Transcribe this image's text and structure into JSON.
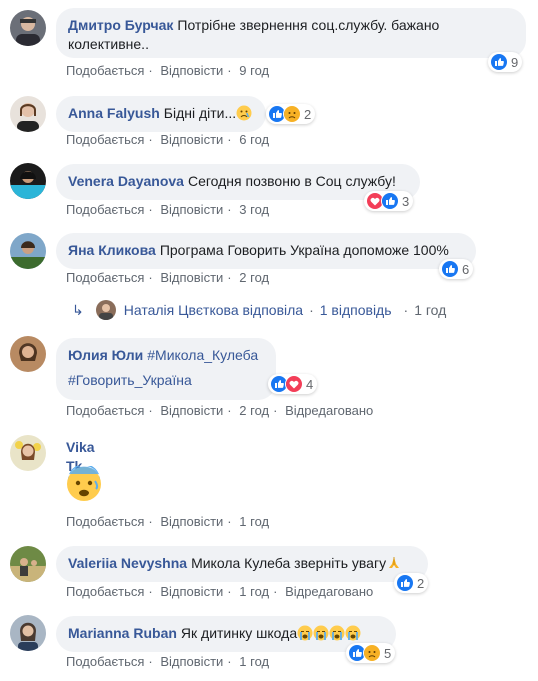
{
  "colors": {
    "link": "#385898",
    "bubble": "#f0f2f5",
    "meta": "#606770",
    "like_blue": "#1877f2",
    "love_red": "#f33e58",
    "haha_yellow": "#f7b125"
  },
  "actions": {
    "like": "Подобається",
    "reply": "Відповісти",
    "edited": "Відредаговано"
  },
  "comments": [
    {
      "author": "Дмитро Бурчак",
      "text": "Потрібне звернення соц.службу. бажано колективне..",
      "time": "9 год",
      "reactions": [
        "like"
      ],
      "count": "9"
    },
    {
      "author": "Anna Falyush",
      "text": "Бідні діти...",
      "emoji": "sad",
      "time": "6 год",
      "reactions": [
        "like",
        "sad"
      ],
      "count": "2"
    },
    {
      "author": "Venera Dayanova",
      "text": "Сегодня позвоню в Соц службу!",
      "time": "3 год",
      "reactions": [
        "love",
        "like"
      ],
      "count": "3"
    },
    {
      "author": "Яна Кликова",
      "text": "Програма Говорить Україна допоможе 100%",
      "time": "2 год",
      "reactions": [
        "like"
      ],
      "count": "6"
    },
    {
      "author": "Юлия Юли",
      "tag1": "#Микола_Кулеба",
      "tag2": "#Говорить_Україна",
      "time": "2 год",
      "reactions": [
        "like",
        "love"
      ],
      "count": "4"
    },
    {
      "author": "Vika Tk",
      "emoji": "anxious",
      "time": "1 год"
    },
    {
      "author": "Valeriia Nevyshna",
      "text": "Микола Кулеба зверніть увагу",
      "emoji": "pray",
      "time": "1 год",
      "reactions": [
        "like"
      ],
      "count": "2"
    },
    {
      "author": "Marianna Ruban",
      "text": "Як дитинку шкода",
      "emoji": "cry",
      "time": "1 год",
      "reactions": [
        "like",
        "sad"
      ],
      "count": "5"
    }
  ],
  "reply": {
    "author_text": "Наталія Цвєткова відповіла",
    "count": "1 відповідь",
    "time": "1 год"
  }
}
